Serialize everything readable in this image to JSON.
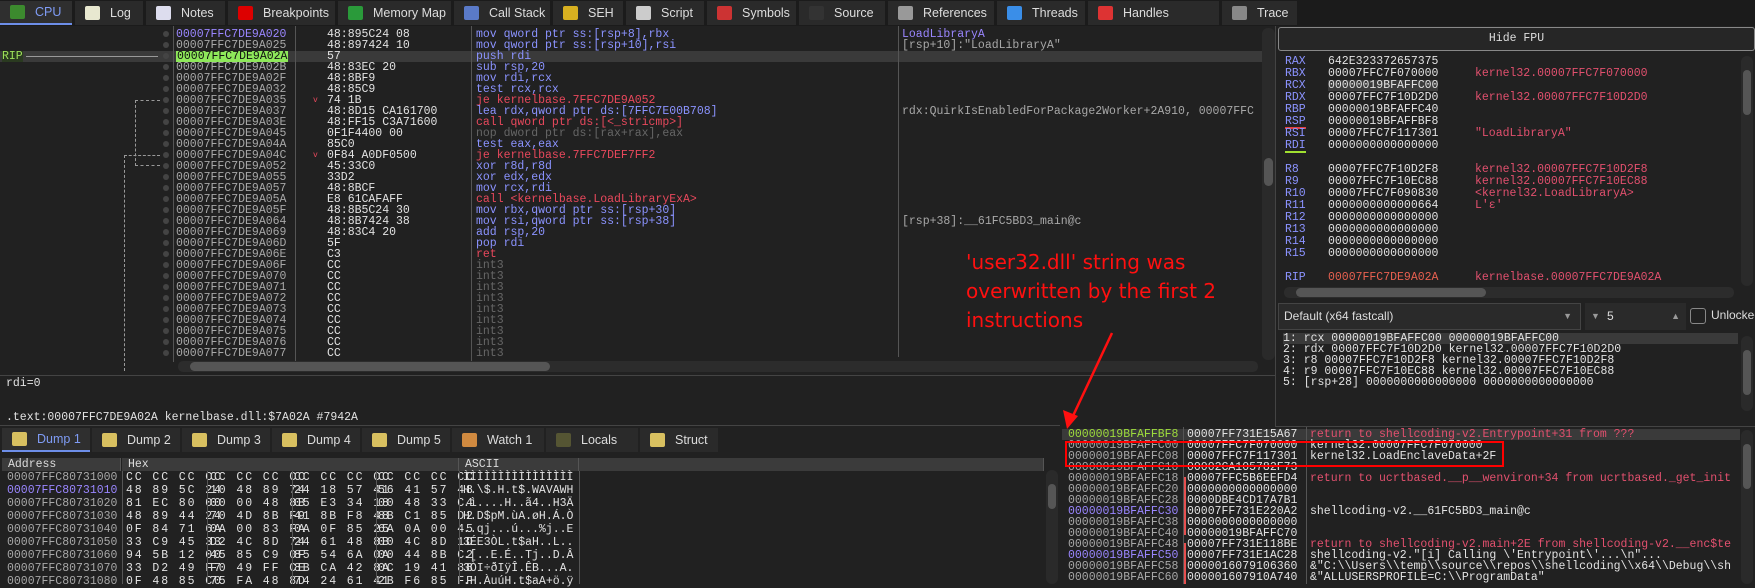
{
  "tabs": [
    {
      "label": "CPU",
      "icon": "cpu-icon",
      "color": "#3c8a2e"
    },
    {
      "label": "Log",
      "icon": "log-icon",
      "color": "#e8e8d0"
    },
    {
      "label": "Notes",
      "icon": "notes-icon",
      "color": "#dde"
    },
    {
      "label": "Breakpoints",
      "icon": "breakpoint-icon",
      "color": "#d00"
    },
    {
      "label": "Memory Map",
      "icon": "memory-map-icon",
      "color": "#2a9a3a"
    },
    {
      "label": "Call Stack",
      "icon": "call-stack-icon",
      "color": "#5a7ac8"
    },
    {
      "label": "SEH",
      "icon": "seh-icon",
      "color": "#d8b020"
    },
    {
      "label": "Script",
      "icon": "script-icon",
      "color": "#ccc"
    },
    {
      "label": "Symbols",
      "icon": "symbols-icon",
      "color": "#c33"
    },
    {
      "label": "Source",
      "icon": "source-icon",
      "color": "#333"
    },
    {
      "label": "References",
      "icon": "references-icon",
      "color": "#999"
    },
    {
      "label": "Threads",
      "icon": "threads-icon",
      "color": "#3a8ee8"
    },
    {
      "label": "Handles",
      "icon": "handles-icon",
      "color": "#d33"
    },
    {
      "label": "Trace",
      "icon": "trace-icon",
      "color": "#888"
    }
  ],
  "disasm": {
    "rip_label": "RIP",
    "rows": [
      {
        "addr": "00007FFC7DE9A020",
        "bytes": "48:895C24 08",
        "instr": "mov qword ptr ss:[rsp+8],rbx",
        "comment": "LoadLibraryA",
        "kind": "normal",
        "addr_style": "purple"
      },
      {
        "addr": "00007FFC7DE9A025",
        "bytes": "48:897424 10",
        "instr": "mov qword ptr ss:[rsp+10],rsi",
        "comment": "[rsp+10]:\"LoadLibraryA\"",
        "kind": "normal"
      },
      {
        "addr": "00007FFC7DE9A02A",
        "bytes": "57",
        "instr": "push rdi",
        "comment": "",
        "kind": "normal",
        "rip": true
      },
      {
        "addr": "00007FFC7DE9A02B",
        "bytes": "48:83EC 20",
        "instr": "sub rsp,20",
        "comment": "",
        "kind": "normal"
      },
      {
        "addr": "00007FFC7DE9A02F",
        "bytes": "48:8BF9",
        "instr": "mov rdi,rcx",
        "comment": "",
        "kind": "normal"
      },
      {
        "addr": "00007FFC7DE9A032",
        "bytes": "48:85C9",
        "instr": "test rcx,rcx",
        "comment": "",
        "kind": "normal"
      },
      {
        "addr": "00007FFC7DE9A035",
        "bytes": "74 1B",
        "instr": "je kernelbase.7FFC7DE9A052",
        "comment": "",
        "kind": "branch",
        "jump": true
      },
      {
        "addr": "00007FFC7DE9A037",
        "bytes": "48:8D15 CA161700",
        "instr": "lea rdx,qword ptr ds:[7FFC7E00B708]",
        "comment": "rdx:QuirkIsEnabledForPackage2Worker+2A910, 00007FFC",
        "kind": "normal"
      },
      {
        "addr": "00007FFC7DE9A03E",
        "bytes": "48:FF15 C3A71600",
        "instr": "call qword ptr ds:[<_stricmp>]",
        "comment": "",
        "kind": "branch"
      },
      {
        "addr": "00007FFC7DE9A045",
        "bytes": "0F1F4400 00",
        "instr": "nop dword ptr ds:[rax+rax],eax",
        "comment": "",
        "kind": "nop"
      },
      {
        "addr": "00007FFC7DE9A04A",
        "bytes": "85C0",
        "instr": "test eax,eax",
        "comment": "",
        "kind": "normal"
      },
      {
        "addr": "00007FFC7DE9A04C",
        "bytes": "0F84 A0DF0500",
        "instr": "je kernelbase.7FFC7DEF7FF2",
        "comment": "",
        "kind": "branch",
        "jump": true
      },
      {
        "addr": "00007FFC7DE9A052",
        "bytes": "45:33C0",
        "instr": "xor r8d,r8d",
        "comment": "",
        "kind": "normal"
      },
      {
        "addr": "00007FFC7DE9A055",
        "bytes": "33D2",
        "instr": "xor edx,edx",
        "comment": "",
        "kind": "normal"
      },
      {
        "addr": "00007FFC7DE9A057",
        "bytes": "48:8BCF",
        "instr": "mov rcx,rdi",
        "comment": "",
        "kind": "normal"
      },
      {
        "addr": "00007FFC7DE9A05A",
        "bytes": "E8 61CAFAFF",
        "instr": "call <kernelbase.LoadLibraryExA>",
        "comment": "",
        "kind": "branch"
      },
      {
        "addr": "00007FFC7DE9A05F",
        "bytes": "48:8B5C24 30",
        "instr": "mov rbx,qword ptr ss:[rsp+30]",
        "comment": "",
        "kind": "normal"
      },
      {
        "addr": "00007FFC7DE9A064",
        "bytes": "48:8B7424 38",
        "instr": "mov rsi,qword ptr ss:[rsp+38]",
        "comment": "[rsp+38]:__61FC5BD3_main@c",
        "kind": "normal"
      },
      {
        "addr": "00007FFC7DE9A069",
        "bytes": "48:83C4 20",
        "instr": "add rsp,20",
        "comment": "",
        "kind": "normal"
      },
      {
        "addr": "00007FFC7DE9A06D",
        "bytes": "5F",
        "instr": "pop rdi",
        "comment": "",
        "kind": "normal"
      },
      {
        "addr": "00007FFC7DE9A06E",
        "bytes": "C3",
        "instr": "ret",
        "comment": "",
        "kind": "branch"
      },
      {
        "addr": "00007FFC7DE9A06F",
        "bytes": "CC",
        "instr": "int3",
        "comment": "",
        "kind": "nop"
      },
      {
        "addr": "00007FFC7DE9A070",
        "bytes": "CC",
        "instr": "int3",
        "comment": "",
        "kind": "nop"
      },
      {
        "addr": "00007FFC7DE9A071",
        "bytes": "CC",
        "instr": "int3",
        "comment": "",
        "kind": "nop"
      },
      {
        "addr": "00007FFC7DE9A072",
        "bytes": "CC",
        "instr": "int3",
        "comment": "",
        "kind": "nop"
      },
      {
        "addr": "00007FFC7DE9A073",
        "bytes": "CC",
        "instr": "int3",
        "comment": "",
        "kind": "nop"
      },
      {
        "addr": "00007FFC7DE9A074",
        "bytes": "CC",
        "instr": "int3",
        "comment": "",
        "kind": "nop"
      },
      {
        "addr": "00007FFC7DE9A075",
        "bytes": "CC",
        "instr": "int3",
        "comment": "",
        "kind": "nop"
      },
      {
        "addr": "00007FFC7DE9A076",
        "bytes": "CC",
        "instr": "int3",
        "comment": "",
        "kind": "nop"
      },
      {
        "addr": "00007FFC7DE9A077",
        "bytes": "CC",
        "instr": "int3",
        "comment": "",
        "kind": "nop"
      }
    ]
  },
  "info": {
    "line1": "rdi=0",
    "line2": ".text:00007FFC7DE9A02A kernelbase.dll:$7A02A #7942A"
  },
  "registers": {
    "hide_fpu": "Hide FPU",
    "rows": [
      {
        "name": "RAX",
        "value": "642E323372657375",
        "comment": ""
      },
      {
        "name": "RBX",
        "value": "00007FFC7F070000",
        "comment": "kernel32.00007FFC7F070000"
      },
      {
        "name": "RCX",
        "value": "00000019BFAFFC00",
        "comment": "",
        "highlight": true
      },
      {
        "name": "RDX",
        "value": "00007FFC7F10D2D0",
        "comment": "kernel32.00007FFC7F10D2D0"
      },
      {
        "name": "RBP",
        "value": "00000019BFAFFC40",
        "comment": ""
      },
      {
        "name": "RSP",
        "value": "00000019BFAFFBF8",
        "comment": "",
        "underline": "#e04040"
      },
      {
        "name": "RSI",
        "value": "00007FFC7F117301",
        "comment": "\"LoadLibraryA\""
      },
      {
        "name": "RDI",
        "value": "0000000000000000",
        "comment": "",
        "underline": "#a0e030"
      },
      {
        "name": "R8",
        "value": "00007FFC7F10D2F8",
        "comment": "kernel32.00007FFC7F10D2F8",
        "gap": true
      },
      {
        "name": "R9",
        "value": "00007FFC7F10EC88",
        "comment": "kernel32.00007FFC7F10EC88"
      },
      {
        "name": "R10",
        "value": "00007FFC7F090830",
        "comment": "<kernel32.LoadLibraryA>"
      },
      {
        "name": "R11",
        "value": "0000000000000664",
        "comment": "L'ɛ'"
      },
      {
        "name": "R12",
        "value": "0000000000000000",
        "comment": ""
      },
      {
        "name": "R13",
        "value": "0000000000000000",
        "comment": ""
      },
      {
        "name": "R14",
        "value": "0000000000000000",
        "comment": ""
      },
      {
        "name": "R15",
        "value": "0000000000000000",
        "comment": ""
      },
      {
        "name": "RIP",
        "value": "00007FFC7DE9A02A",
        "comment": "kernelbase.00007FFC7DE9A02A",
        "gap": true,
        "value_red": true
      }
    ]
  },
  "callconv": {
    "selected": "Default (x64 fastcall)",
    "count": "5",
    "unlocked_label": "Unlocked",
    "args": [
      "1: rcx 00000019BFAFFC00 00000019BFAFFC00",
      "2: rdx 00007FFC7F10D2D0 kernel32.00007FFC7F10D2D0",
      "3: r8 00007FFC7F10D2F8 kernel32.00007FFC7F10D2F8",
      "4: r9 00007FFC7F10EC88 kernel32.00007FFC7F10EC88",
      "5: [rsp+28] 0000000000000000 0000000000000000"
    ]
  },
  "dump_tabs": [
    {
      "label": "Dump 1",
      "icon": "dump-icon"
    },
    {
      "label": "Dump 2",
      "icon": "dump-icon"
    },
    {
      "label": "Dump 3",
      "icon": "dump-icon"
    },
    {
      "label": "Dump 4",
      "icon": "dump-icon"
    },
    {
      "label": "Dump 5",
      "icon": "dump-icon"
    },
    {
      "label": "Watch 1",
      "icon": "watch-icon"
    },
    {
      "label": "Locals",
      "icon": "locals-icon"
    },
    {
      "label": "Struct",
      "icon": "struct-icon"
    }
  ],
  "dump": {
    "headers": {
      "address": "Address",
      "hex": "Hex",
      "ascii": "ASCII"
    },
    "rows": [
      {
        "addr": "00007FFC80731000",
        "hex": [
          "CC CC CC CC",
          "CC CC CC CC",
          "CC CC CC CC",
          "CC CC CC CC"
        ],
        "ascii": "ÌÌÌÌÌÌÌÌÌÌÌÌÌÌÌÌ"
      },
      {
        "addr": "00007FFC80731010",
        "hex": [
          "48 89 5C 24",
          "10 48 89 74",
          "24 18 57 41",
          "56 41 57 48"
        ],
        "ascii": "H.\\$.H.t$.WAVAWH",
        "purple": true
      },
      {
        "addr": "00007FFC80731020",
        "hex": [
          "81 EC 80 00",
          "00 00 48 8B",
          "05 E3 34 18",
          "00 48 33 C4"
        ],
        "ascii": ".ì....H..ã4..H3Ä"
      },
      {
        "addr": "00007FFC80731030",
        "hex": [
          "48 89 44 24",
          "70 4D 8B F9",
          "41 8B F8 48",
          "8B C1 85 D2"
        ],
        "ascii": "H.D$pM.ùA.øH.Á.Ò"
      },
      {
        "addr": "00007FFC80731040",
        "hex": [
          "0F 84 71 6A",
          "0A 00 83 FA",
          "0A 0F 85 25",
          "6A 0A 00 45"
        ],
        "ascii": "..qj...ú...%j..E"
      },
      {
        "addr": "00007FFC80731050",
        "hex": [
          "33 C9 45 33",
          "D2 4C 8D 74",
          "24 61 48 8B",
          "00 4C 8D 1D"
        ],
        "ascii": "3ÉE3ÒL.t$aH..L.."
      },
      {
        "addr": "00007FFC80731060",
        "hex": [
          "94 5B 12 00",
          "45 85 C9 0F",
          "85 54 6A 0A",
          "00 44 8B C2"
        ],
        "ascii": ".[..E.É..Tj..D.Â"
      },
      {
        "addr": "00007FFC80731070",
        "hex": [
          "33 D2 49 F7",
          "F0 49 FF CE",
          "8B CA 42 8A",
          "0C 19 41 88"
        ],
        "ascii": "3ÒI÷ðIÿÎ.ÊB...A."
      },
      {
        "addr": "00007FFC80731080",
        "hex": [
          "0F 48 85 C0",
          "75 FA 48 8D",
          "74 24 61 41",
          "2B F6 85 FF"
        ],
        "ascii": ".H.ÀuúH.t$aA+ö.ÿ"
      }
    ]
  },
  "stack": {
    "rows": [
      {
        "addr": "00000019BFAFFBF8",
        "value": "00007FF731E15A67",
        "comment": "return to shellcoding-v2.Entrypoint+31 from ???",
        "style": "ret",
        "addr_style": "green"
      },
      {
        "addr": "00000019BFAFFC00",
        "value": "00007FFC7F070000",
        "comment": "kernel32.00007FFC7F070000"
      },
      {
        "addr": "00000019BFAFFC08",
        "value": "00007FFC7F117301",
        "comment": "kernel32.LoadEnclaveData+2F"
      },
      {
        "addr": "00000019BFAFFC10",
        "value": "00002CA105782F73",
        "comment": ""
      },
      {
        "addr": "00000019BFAFFC18",
        "value": "00007FFC5B6EEFD4",
        "comment": "return to ucrtbased.__p__wenviron+34 from ucrtbased._get_init",
        "style": "ret"
      },
      {
        "addr": "00000019BFAFFC20",
        "value": "0000000000000000",
        "comment": ""
      },
      {
        "addr": "00000019BFAFFC28",
        "value": "0000DBE4CD17A7B1",
        "comment": ""
      },
      {
        "addr": "00000019BFAFFC30",
        "value": "00007FF731E220A2",
        "comment": "shellcoding-v2.__61FC5BD3_main@c",
        "addr_style": "purple"
      },
      {
        "addr": "00000019BFAFFC38",
        "value": "0000000000000000",
        "comment": ""
      },
      {
        "addr": "00000019BFAFFC40",
        "value": "00000019BFAFFC70",
        "comment": ""
      },
      {
        "addr": "00000019BFAFFC48",
        "value": "00007FF731E118BE",
        "comment": "return to shellcoding-v2.main+2E from shellcoding-v2.__enc$te",
        "style": "ret"
      },
      {
        "addr": "00000019BFAFFC50",
        "value": "00007FF731E1AC28",
        "comment": "shellcoding-v2.\"[i] Calling \\'Entrypoint\\'...\\n\"...",
        "addr_style": "purple"
      },
      {
        "addr": "00000019BFAFFC58",
        "value": "0000016079106360",
        "comment": "&\"C:\\\\Users\\\\temp\\\\source\\\\repos\\\\shellcoding\\\\x64\\\\Debug\\\\sh"
      },
      {
        "addr": "00000019BFAFFC60",
        "value": "000001607910A740",
        "comment": "&\"ALLUSERSPROFILE=C:\\\\ProgramData\""
      }
    ]
  },
  "annotation": {
    "lines": [
      "'user32.dll' string was",
      "overwritten by the first 2",
      "instructions"
    ],
    "color": "#ff1010"
  }
}
